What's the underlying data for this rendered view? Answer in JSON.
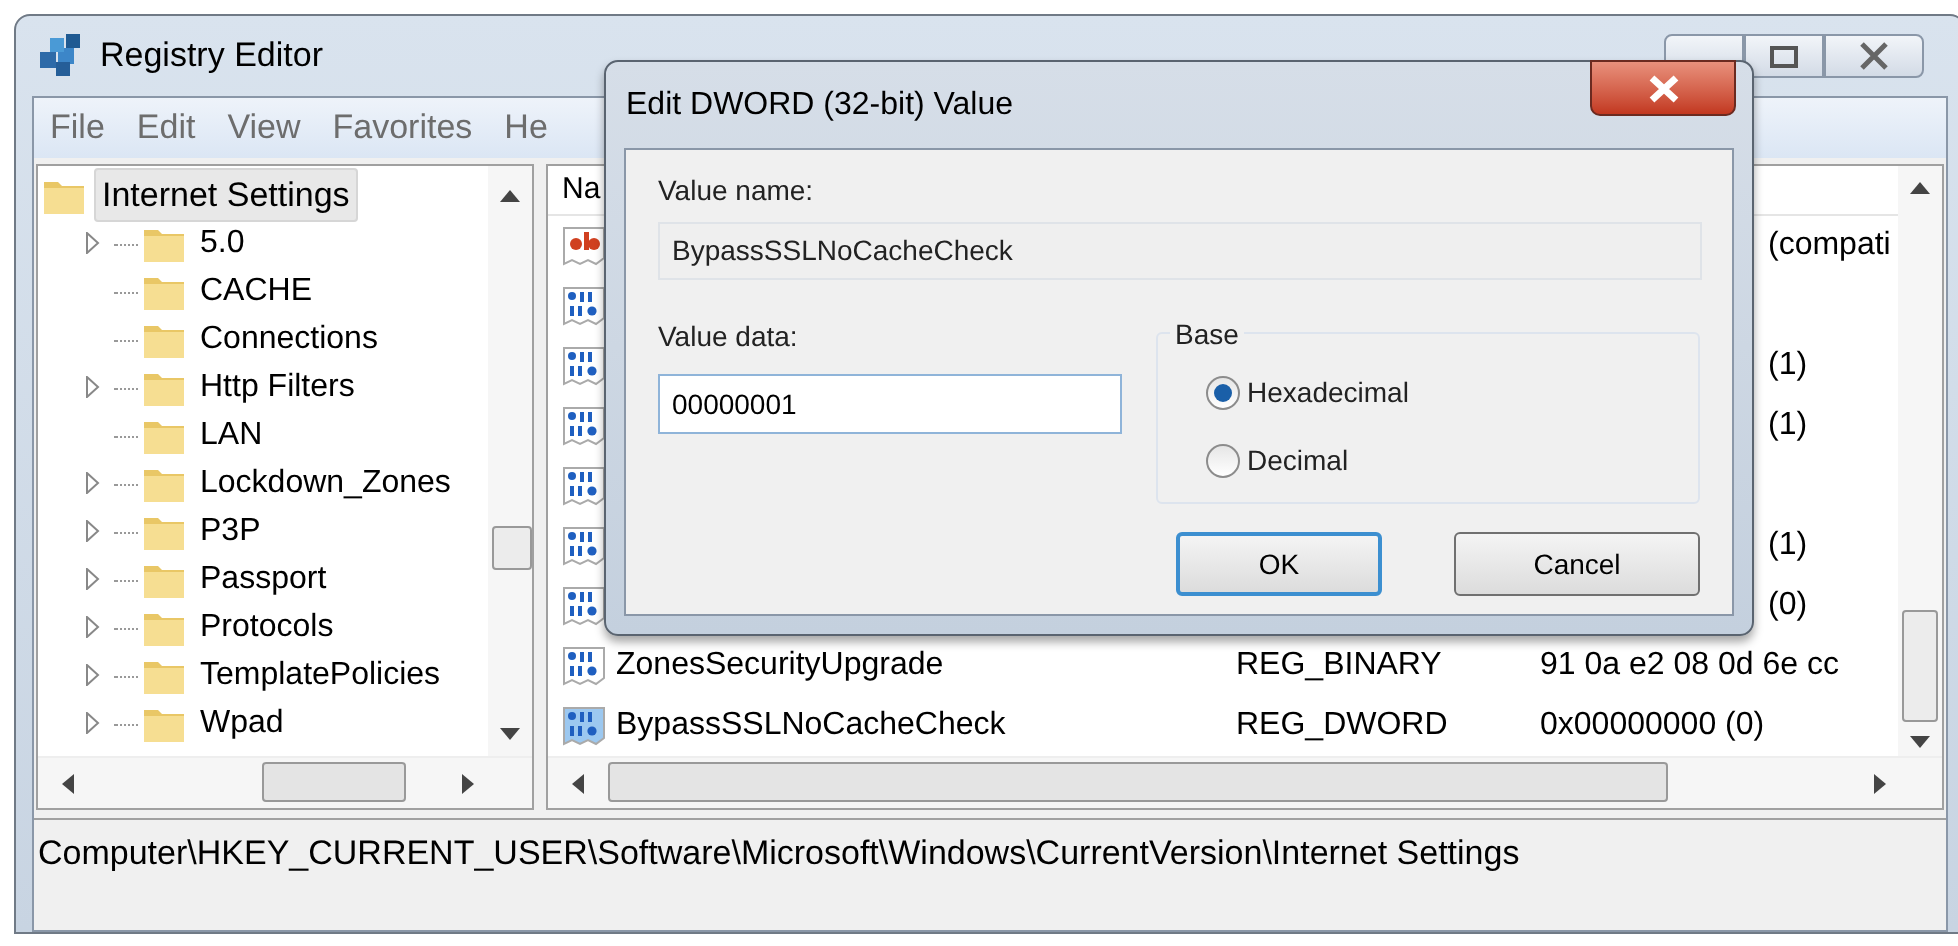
{
  "window": {
    "title": "Registry Editor"
  },
  "menu": [
    "File",
    "Edit",
    "View",
    "Favorites",
    "He"
  ],
  "tree": {
    "label": "Internet Settings",
    "selected": true,
    "children": [
      {
        "label": "5.0",
        "expandable": true
      },
      {
        "label": "CACHE",
        "expandable": false
      },
      {
        "label": "Connections",
        "expandable": false
      },
      {
        "label": "Http Filters",
        "expandable": true
      },
      {
        "label": "LAN",
        "expandable": false
      },
      {
        "label": "Lockdown_Zones",
        "expandable": true
      },
      {
        "label": "P3P",
        "expandable": true
      },
      {
        "label": "Passport",
        "expandable": true
      },
      {
        "label": "Protocols",
        "expandable": true
      },
      {
        "label": "TemplatePolicies",
        "expandable": true
      },
      {
        "label": "Wpad",
        "expandable": true
      }
    ]
  },
  "list": {
    "column_1": "Na",
    "rows": [
      {
        "kind": "partial",
        "value": "(compati"
      },
      {
        "kind": "partial"
      },
      {
        "kind": "partial",
        "value": "(1)"
      },
      {
        "kind": "partial",
        "value": "(1)"
      },
      {
        "kind": "partial"
      },
      {
        "kind": "partial",
        "value": "(1)"
      },
      {
        "kind": "partial",
        "value": "(0)"
      },
      {
        "kind": "full",
        "name": "ZonesSecurityUpgrade",
        "type": "REG_BINARY",
        "value": "91 0a e2 08 0d 6e cc"
      },
      {
        "kind": "full",
        "name": "BypassSSLNoCacheCheck",
        "type": "REG_DWORD",
        "value": "0x00000000 (0)",
        "selected": true
      }
    ]
  },
  "status_bar": "Computer\\HKEY_CURRENT_USER\\Software\\Microsoft\\Windows\\CurrentVersion\\Internet Settings",
  "dialog": {
    "title": "Edit DWORD (32-bit) Value",
    "value_name_label": "Value name:",
    "value_name": "BypassSSLNoCacheCheck",
    "value_data_label": "Value data:",
    "value_data": "00000001",
    "base_label": "Base",
    "base_options": [
      {
        "label": "Hexadecimal",
        "selected": true
      },
      {
        "label": "Decimal",
        "selected": false
      }
    ],
    "buttons": [
      {
        "label": "OK",
        "default": true
      },
      {
        "label": "Cancel",
        "default": false
      }
    ]
  }
}
